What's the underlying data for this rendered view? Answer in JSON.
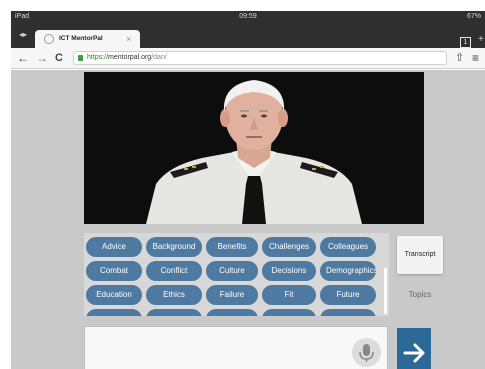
{
  "status_bar": {
    "carrier": "iPad",
    "time": "09:59",
    "battery": "67%"
  },
  "tab_bar": {
    "active_tab_title": "ICT MentorPal",
    "tab_close_glyph": "×",
    "tab_back_glyph": "◂▸",
    "tab_count": "1",
    "more_glyph": "+"
  },
  "nav_bar": {
    "back_glyph": "←",
    "forward_glyph": "→",
    "reload_glyph": "C",
    "url_scheme": "https://",
    "url_host": "mentorpal.org",
    "url_path": "/dan/",
    "share_glyph": "⇧",
    "menu_glyph": "≡"
  },
  "topics": {
    "rows": [
      [
        "Advice",
        "Background",
        "Benefits",
        "Challenges",
        "Colleagues"
      ],
      [
        "Combat",
        "Conflict",
        "Culture",
        "Decisions",
        "Demographics"
      ],
      [
        "Education",
        "Ethics",
        "Failure",
        "Fit",
        "Future"
      ]
    ]
  },
  "side_tabs": {
    "transcript_label": "Transcript",
    "topics_label": "Topics"
  },
  "input": {
    "placeholder": ""
  },
  "colors": {
    "topic_button": "#4e79a1",
    "send_button": "#2b6a96",
    "page_background": "#c9c9c9",
    "video_background": "#0d0d0d"
  },
  "icons": {
    "video": "mentor-video",
    "mic": "microphone-icon",
    "send": "arrow-right-icon",
    "lock": "lock-icon",
    "favicon": "site-favicon"
  }
}
